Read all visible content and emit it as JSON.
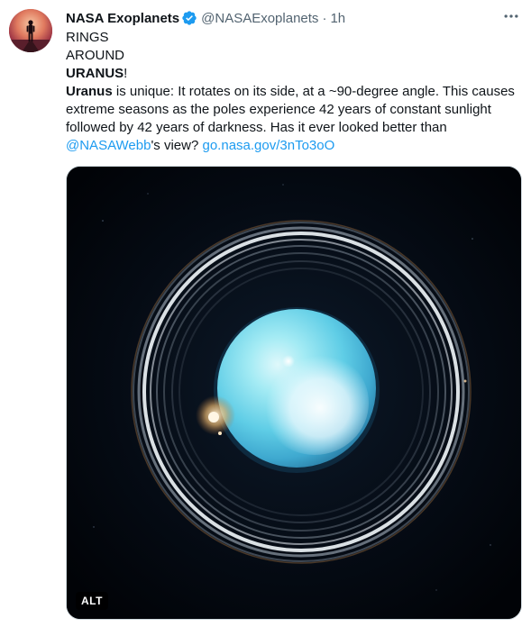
{
  "account": {
    "display_name": "NASA Exoplanets",
    "handle": "@NASAExoplanets",
    "separator": "·",
    "timestamp": "1h",
    "verified_icon": "verified-badge-icon"
  },
  "tweet": {
    "line1": "RINGS",
    "line2": "AROUND",
    "line3_bold": "URANUS",
    "line3_rest": "!",
    "body_bold": "Uranus",
    "body_text_1": " is unique: It rotates on its side, at a ~90-degree angle. This causes extreme seasons as the poles experience 42 years of constant sunlight followed by 42 years of darkness. Has it ever looked better than ",
    "mention": "@NASAWebb",
    "body_text_2": "'s view? ",
    "url": "go.nasa.gov/3nTo3oO"
  },
  "media": {
    "alt_label": "ALT"
  },
  "colors": {
    "accent": "#1d9bf0",
    "secondary_text": "#536471",
    "primary_text": "#0f1419"
  }
}
